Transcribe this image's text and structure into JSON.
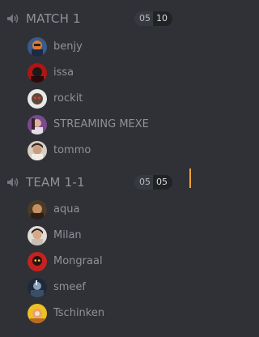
{
  "channels": [
    {
      "name": "MATCH 1",
      "user_count": "05",
      "user_limit": "10",
      "users": [
        {
          "name": "benjy"
        },
        {
          "name": "issa"
        },
        {
          "name": "rockit"
        },
        {
          "name": "STREAMING MEXE"
        },
        {
          "name": "tommo"
        }
      ]
    },
    {
      "name": "TEAM 1-1",
      "user_count": "05",
      "user_limit": "05",
      "users": [
        {
          "name": "aqua"
        },
        {
          "name": "Milan"
        },
        {
          "name": "Mongraal"
        },
        {
          "name": "smeef"
        },
        {
          "name": "Tschinken"
        }
      ]
    }
  ],
  "colors": {
    "background": "#2f3136",
    "channel_text": "#8e9297",
    "accent": "#f0a232"
  }
}
